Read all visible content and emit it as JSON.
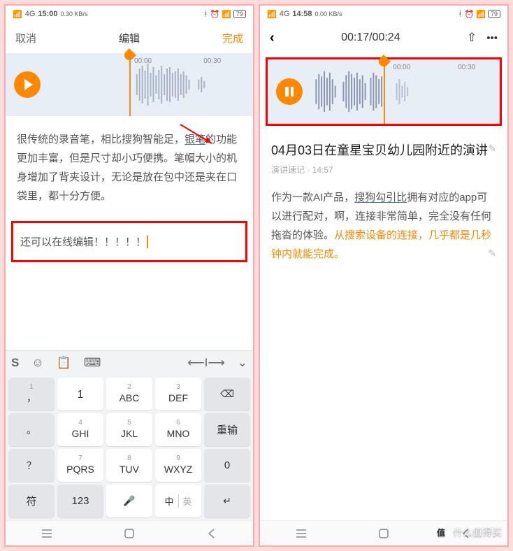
{
  "left": {
    "status": {
      "carrier": "4G",
      "time": "15:00",
      "speed": "0.30 KB/s",
      "battery": "79"
    },
    "nav": {
      "cancel": "取消",
      "title": "编辑",
      "done": "完成"
    },
    "waveform": {
      "time1": "00:00",
      "time2": "00:30",
      "playhead_pct": 50
    },
    "paragraph": {
      "p1_pre": "很传统的录音笔，相比搜狗智能足，",
      "p1_ul": "银笔",
      "p1_post": "的功能更加丰富，但是尺寸却小巧便携。笔帽大小的机身增加了背夹设计，无论是放在包中还是夹在口袋里，都十分方便。"
    },
    "edit_text": "还可以在线编辑！！！！！",
    "keyboard": {
      "keys": [
        {
          "num": "1",
          "main": "，",
          "gray": true
        },
        {
          "num": "",
          "main": "1",
          "sub": ""
        },
        {
          "num": "2",
          "main": "ABC"
        },
        {
          "num": "3",
          "main": "DEF"
        },
        {
          "icon": "backspace",
          "gray": true
        },
        {
          "num": "。",
          "main": "。",
          "gray": true,
          "single": true
        },
        {
          "num": "4",
          "main": "GHI"
        },
        {
          "num": "5",
          "main": "JKL"
        },
        {
          "num": "6",
          "main": "MNO"
        },
        {
          "main": "重输",
          "gray": true,
          "wide": true
        },
        {
          "main": "？",
          "gray": true,
          "single": true
        },
        {
          "num": "7",
          "main": "PQRS"
        },
        {
          "num": "8",
          "main": "TUV"
        },
        {
          "num": "9",
          "main": "WXYZ"
        },
        {
          "main": "0",
          "gray": true,
          "wide": true
        },
        {
          "main": "符",
          "gray": true,
          "wide": true
        },
        {
          "main": "123",
          "gray": true,
          "wide": true
        },
        {
          "icon": "mic"
        },
        {
          "split": [
            "中",
            "英"
          ]
        },
        {
          "icon": "enter",
          "gray": true
        }
      ]
    }
  },
  "right": {
    "status": {
      "carrier": "4G",
      "time": "14:58",
      "speed": "0.00 KB/s",
      "battery": "79"
    },
    "nav": {
      "timer": "00:17/00:24"
    },
    "waveform": {
      "time1": "00:00",
      "time2": "00:30",
      "playhead_pct": 50
    },
    "title": "04月03日在童星宝贝幼儿园附近的演讲",
    "subtitle": "演讲速记 · 14:57",
    "paragraph": {
      "p1": "作为一款AI产品，",
      "p1_ul": "搜狗勾引比",
      "p2": "拥有对应的app可以进行配对，啊，连接非常简单，完全没有任何拖沓的体验。",
      "p3_orange": "从搜索设备的连接，几乎都是几秒钟内就能完成。"
    }
  },
  "watermark": "什么值得买"
}
